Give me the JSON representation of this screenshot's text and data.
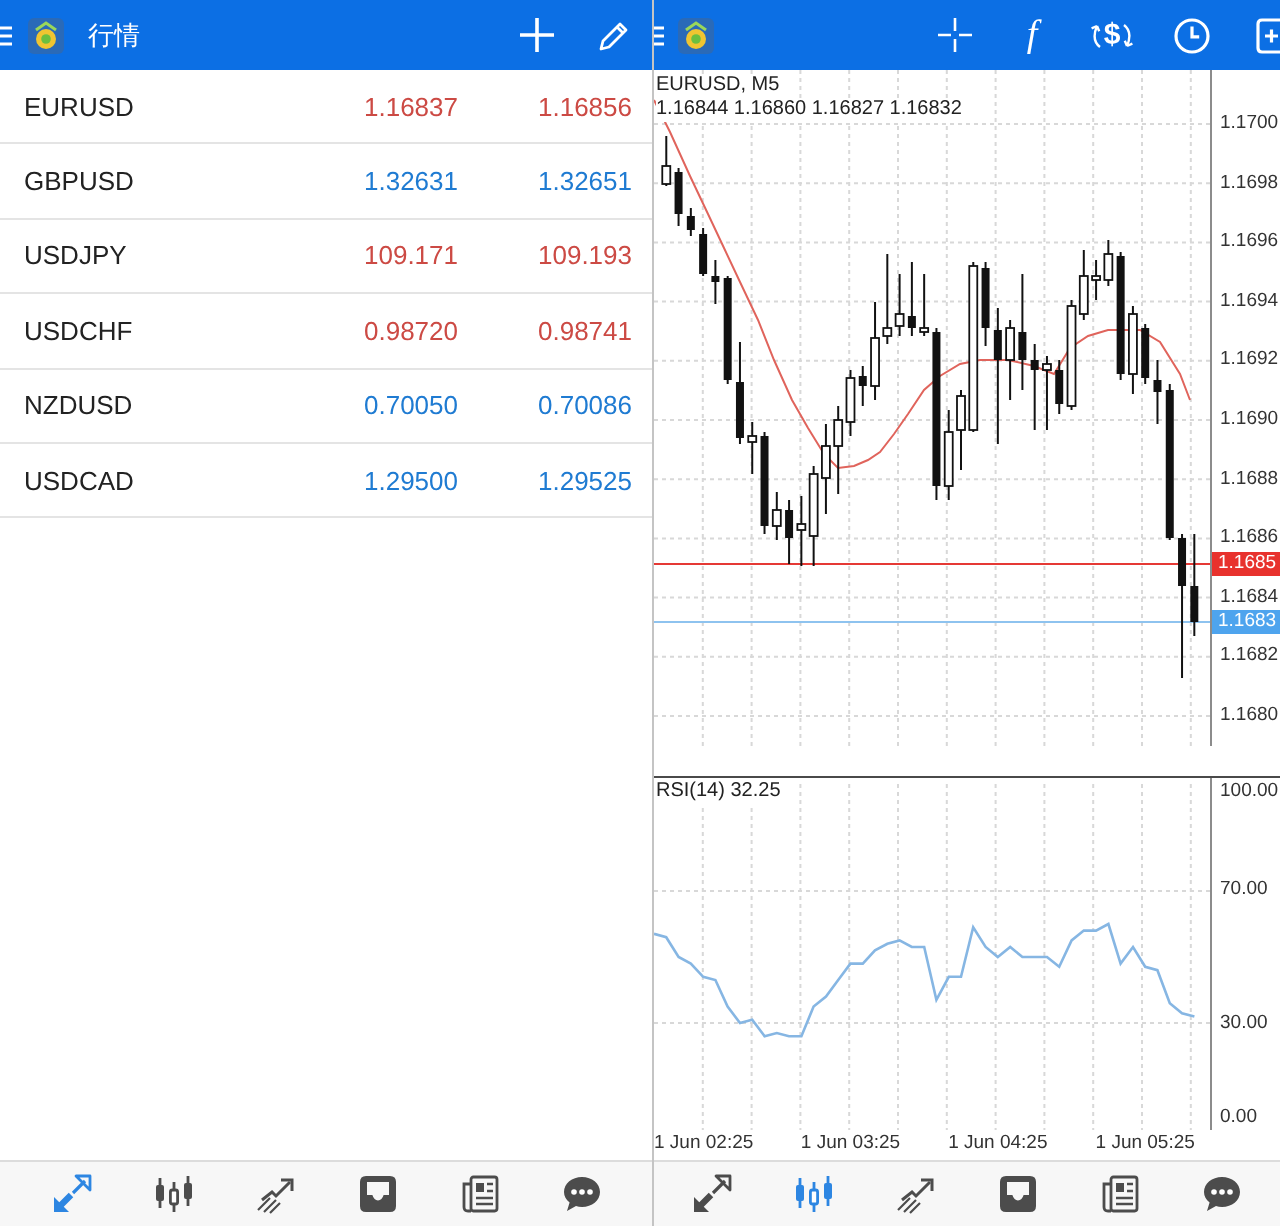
{
  "quotes_screen": {
    "top_bar": {
      "title": "行情"
    },
    "quotes": [
      {
        "symbol": "EURUSD",
        "bid": "1.16837",
        "ask": "1.16856",
        "color": "#cc4a44"
      },
      {
        "symbol": "GBPUSD",
        "bid": "1.32631",
        "ask": "1.32651",
        "color": "#1f7bd2"
      },
      {
        "symbol": "USDJPY",
        "bid": "109.171",
        "ask": "109.193",
        "color": "#cc4a44"
      },
      {
        "symbol": "USDCHF",
        "bid": "0.98720",
        "ask": "0.98741",
        "color": "#cc4a44"
      },
      {
        "symbol": "NZDUSD",
        "bid": "0.70050",
        "ask": "0.70086",
        "color": "#1f7bd2"
      },
      {
        "symbol": "USDCAD",
        "bid": "1.29500",
        "ask": "1.29525",
        "color": "#1f7bd2"
      }
    ],
    "tab_bar": [
      {
        "kind": "quotes",
        "selected": true
      },
      {
        "kind": "chart",
        "selected": false
      },
      {
        "kind": "trade",
        "selected": false
      },
      {
        "kind": "history",
        "selected": false
      },
      {
        "kind": "news",
        "selected": false
      },
      {
        "kind": "chat",
        "selected": false
      }
    ]
  },
  "chart_screen": {
    "top_bar": {
      "function_label": "f",
      "trade_label": "$"
    },
    "price_chart": {
      "symbol_label": "EURUSD, M5",
      "ohlc": "1.16844 1.16860 1.16827 1.16832",
      "price_labels": [
        "1.1700",
        "1.1698",
        "1.1696",
        "1.1694",
        "1.1692",
        "1.1690",
        "1.1688",
        "1.1686",
        "1.1684",
        "1.1682",
        "1.1680"
      ],
      "ask_tag": "1.1685",
      "bid_tag": "1.1683"
    },
    "rsi_panel": {
      "chart_data": {
        "type": "line",
        "title": "RSI(14) 32.25",
        "categories": [
          null,
          null,
          null,
          null,
          "1 Jun 02:25",
          null,
          null,
          null,
          null,
          null,
          null,
          null,
          null,
          null,
          null,
          null,
          "1 Jun 03:25",
          null,
          null,
          null,
          null,
          null,
          null,
          null,
          null,
          null,
          null,
          null,
          "1 Jun 04:25",
          null,
          null,
          null,
          null,
          null,
          null,
          null,
          null,
          null,
          null,
          null,
          "1 Jun 05:25",
          null,
          null,
          null,
          null
        ],
        "series": [
          {
            "color": "#86b6e3",
            "values": [
              57,
              56,
              50,
              48,
              44,
              43,
              35,
              30,
              31,
              26,
              27,
              26,
              26,
              35,
              38,
              43,
              48,
              48,
              52,
              54,
              55,
              53,
              53,
              37,
              44,
              44,
              59,
              53,
              50,
              53,
              50,
              50,
              50,
              47,
              55,
              58,
              58,
              60,
              48,
              53,
              47,
              46,
              36,
              33,
              32
            ]
          }
        ],
        "ylim": [
          -2.4,
          104.2
        ],
        "yticks": [
          {
            "value": 0,
            "label": "0.00"
          },
          {
            "value": 30,
            "label": "30.00"
          },
          {
            "value": 70,
            "label": "70.00"
          },
          {
            "value": 100,
            "label": "100.00"
          }
        ],
        "grid": true
      }
    },
    "tab_bar": [
      {
        "kind": "quotes",
        "selected": false
      },
      {
        "kind": "chart",
        "selected": true
      },
      {
        "kind": "trade",
        "selected": false
      },
      {
        "kind": "history",
        "selected": false
      },
      {
        "kind": "news",
        "selected": false
      },
      {
        "kind": "chat",
        "selected": false
      }
    ]
  }
}
